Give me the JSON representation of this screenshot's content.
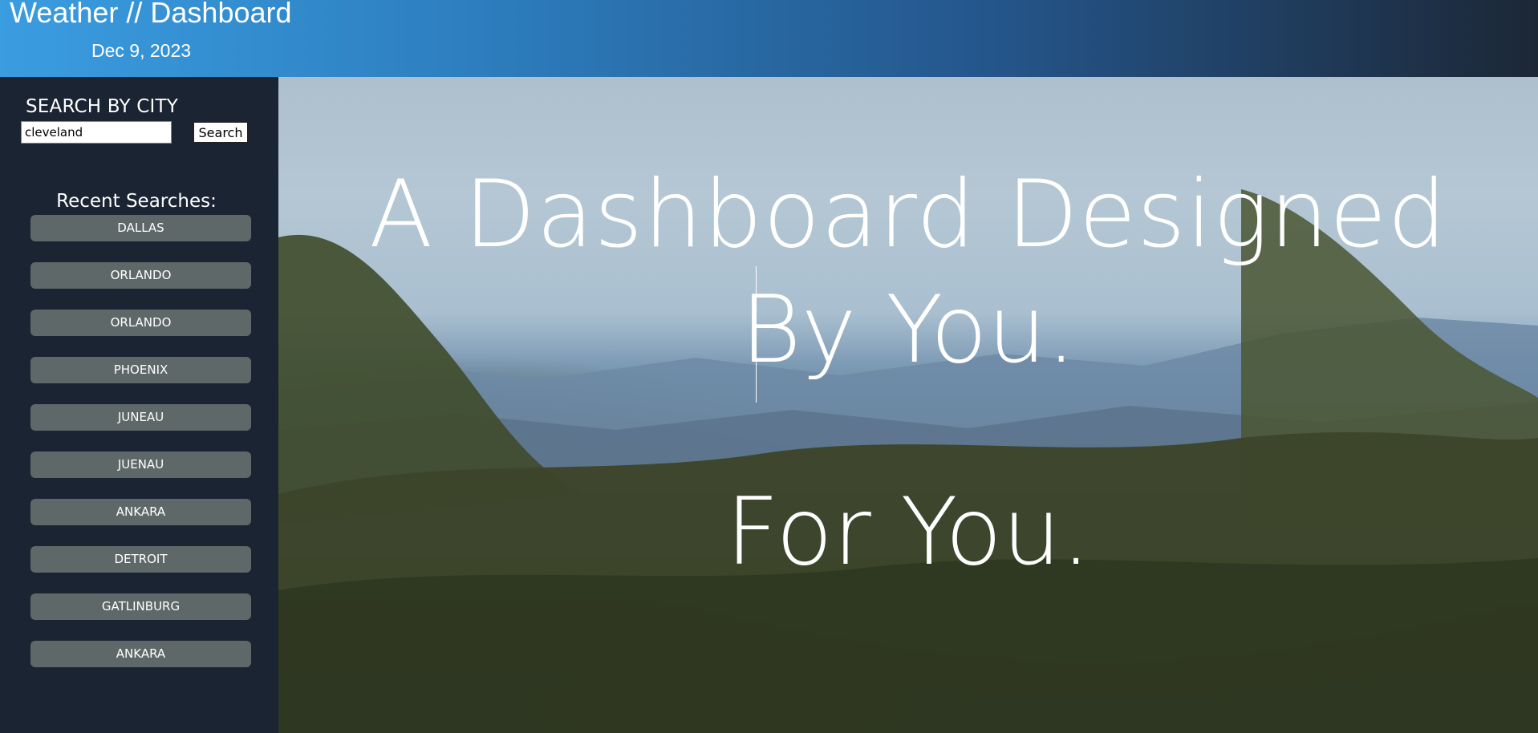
{
  "header": {
    "title": "Weather // Dashboard",
    "date": "Dec 9, 2023"
  },
  "sidebar": {
    "search_heading": "SEARCH BY CITY",
    "search_value": "cleveland",
    "search_button": "Search",
    "recent_heading": "Recent Searches:",
    "recent": [
      "DALLAS",
      "ORLANDO",
      "ORLANDO",
      "PHOENIX",
      "JUNEAU",
      "JUENAU",
      "ANKARA",
      "DETROIT",
      "GATLINBURG",
      "ANKARA"
    ]
  },
  "hero": {
    "line1": "A Dashboard Designed",
    "line2": "By You.",
    "line3": "For You."
  },
  "colors": {
    "header_start": "#3a9de0",
    "header_end": "#1c2736",
    "sidebar_bg": "#1b2433",
    "recent_button_bg": "#5f6868"
  }
}
